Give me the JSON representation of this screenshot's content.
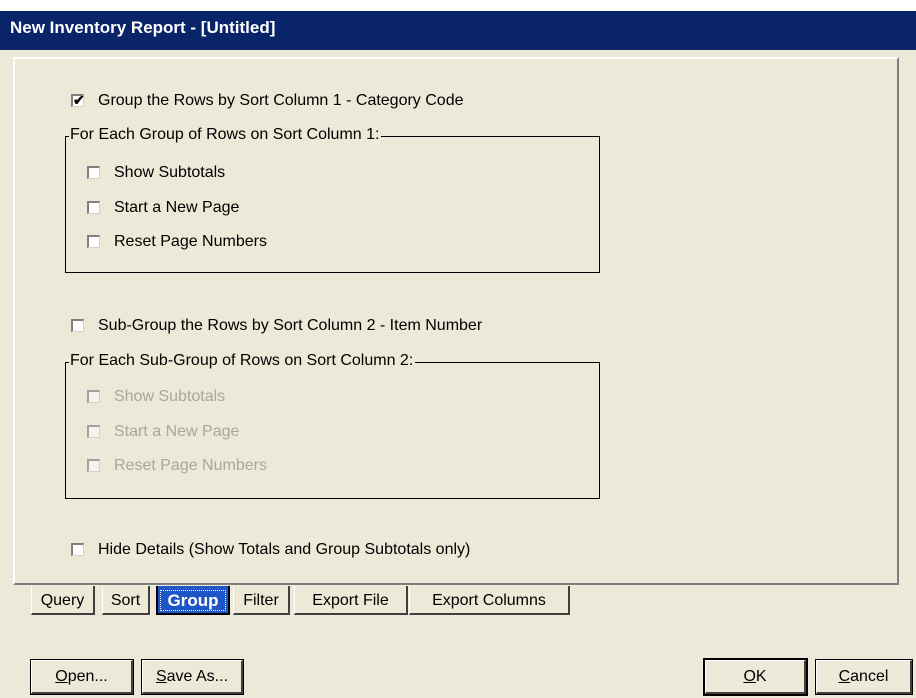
{
  "window": {
    "title": "New Inventory Report - [Untitled]"
  },
  "group1": {
    "checkbox_label": "Group the Rows by Sort Column 1 - Category Code",
    "checked": true,
    "frame_title": "For Each Group of Rows on Sort Column 1:",
    "options": [
      {
        "label": "Show Subtotals",
        "checked": false,
        "enabled": true
      },
      {
        "label": "Start a New Page",
        "checked": false,
        "enabled": true
      },
      {
        "label": "Reset Page Numbers",
        "checked": false,
        "enabled": true
      }
    ]
  },
  "group2": {
    "checkbox_label": "Sub-Group the Rows by Sort Column 2 - Item Number",
    "checked": false,
    "frame_title": "For Each Sub-Group of Rows on Sort Column 2:",
    "options": [
      {
        "label": "Show Subtotals",
        "checked": false,
        "enabled": false
      },
      {
        "label": "Start a New Page",
        "checked": false,
        "enabled": false
      },
      {
        "label": "Reset Page Numbers",
        "checked": false,
        "enabled": false
      }
    ]
  },
  "hide_details": {
    "label": "Hide Details (Show Totals and Group Subtotals only)",
    "checked": false
  },
  "tabs": [
    {
      "label": "Query"
    },
    {
      "label": "Sort"
    },
    {
      "label": "Group",
      "active": true
    },
    {
      "label": "Filter"
    },
    {
      "label": "Export File"
    },
    {
      "label": "Export Columns"
    }
  ],
  "buttons": {
    "open": {
      "pre": "",
      "mnemonic": "O",
      "post": "pen..."
    },
    "save_as": {
      "pre": "",
      "mnemonic": "S",
      "post": "ave As..."
    },
    "ok": {
      "pre": "",
      "mnemonic": "O",
      "post": "K"
    },
    "cancel": {
      "pre": "",
      "mnemonic": "C",
      "post": "ancel"
    }
  },
  "colors": {
    "titlebar": "#0a246a",
    "dialog_bg": "#ece9d8",
    "active_tab": "#1e56c7",
    "disabled_text": "#a7a6a0"
  }
}
